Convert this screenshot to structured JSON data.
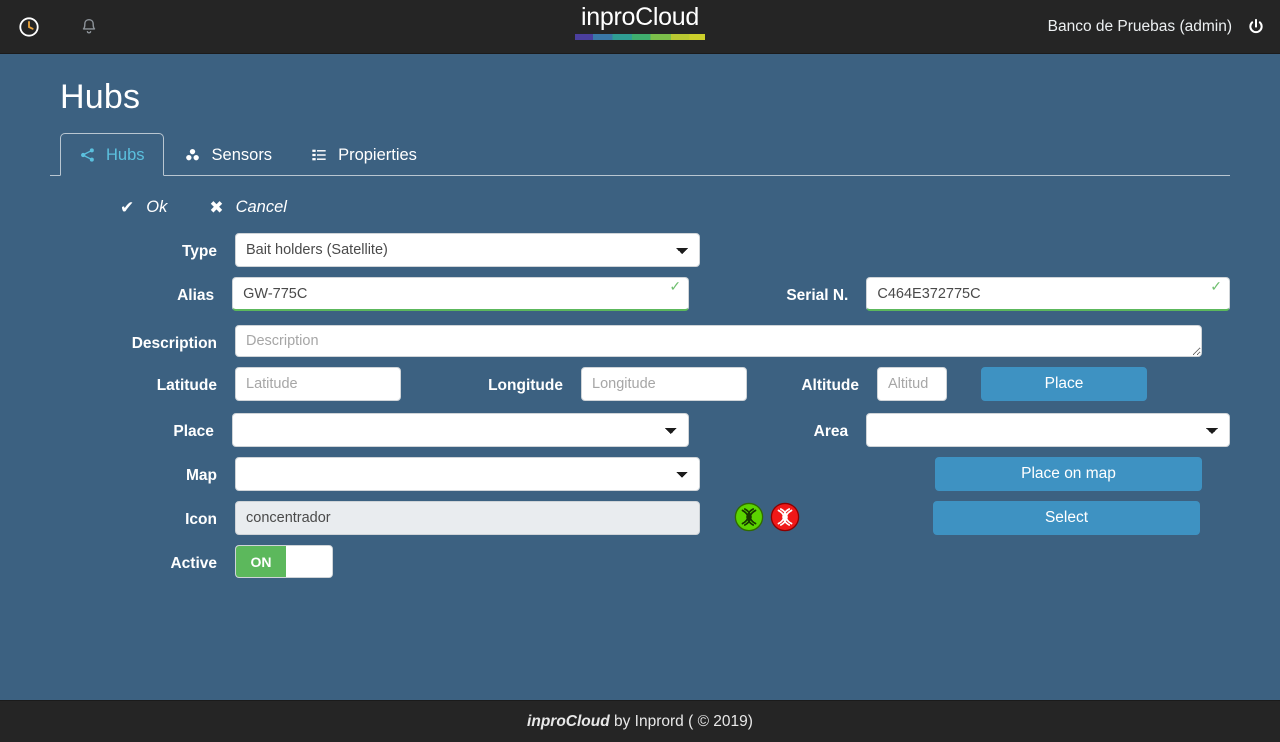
{
  "navbar": {
    "history_icon": "clock-icon",
    "bell_icon": "bell-icon",
    "brand": "inproCloud",
    "user": "Banco de Pruebas (admin)",
    "power_icon": "power-icon",
    "brand_gradient": [
      "#4b3f9e",
      "#3a78a8",
      "#2f9e94",
      "#3fae6e",
      "#7cbf4a",
      "#b9c832",
      "#cdd02b"
    ]
  },
  "page": {
    "title": "Hubs"
  },
  "tabs": [
    {
      "label": "Hubs",
      "icon": "share-nodes-icon",
      "active": true
    },
    {
      "label": "Sensors",
      "icon": "cubes-icon",
      "active": false
    },
    {
      "label": "Propierties",
      "icon": "list-icon",
      "active": false
    }
  ],
  "actions": [
    {
      "label": "Ok",
      "icon": "check-icon",
      "glyph": "✔"
    },
    {
      "label": "Cancel",
      "icon": "times-icon",
      "glyph": "✖"
    }
  ],
  "form": {
    "type": {
      "label": "Type",
      "value": "Bait holders (Satellite)"
    },
    "alias": {
      "label": "Alias",
      "value": "GW-775C",
      "valid": true,
      "valid_glyph": "✓"
    },
    "serial": {
      "label": "Serial N.",
      "value": "C464E372775C",
      "valid": true,
      "valid_glyph": "✓"
    },
    "description": {
      "label": "Description",
      "value": "",
      "placeholder": "Description"
    },
    "latitude": {
      "label": "Latitude",
      "value": "",
      "placeholder": "Latitude"
    },
    "longitude": {
      "label": "Longitude",
      "value": "",
      "placeholder": "Longitude"
    },
    "altitude": {
      "label": "Altitude",
      "value": "",
      "placeholder": "Altitud"
    },
    "place_button": {
      "label": "Place"
    },
    "place": {
      "label": "Place",
      "value": ""
    },
    "area": {
      "label": "Area",
      "value": ""
    },
    "map": {
      "label": "Map",
      "value": ""
    },
    "place_on_map_button": {
      "label": "Place on map"
    },
    "icon": {
      "label": "Icon",
      "value": "concentrador"
    },
    "icon_green": "hub-icon-green",
    "icon_red": "hub-icon-red",
    "select_button": {
      "label": "Select"
    },
    "active": {
      "label": "Active",
      "state": "ON"
    }
  },
  "colors": {
    "page_bg": "#3c6181",
    "navbar_bg": "#252525",
    "accent": "#3e92c2",
    "tab_active_text": "#5bc0de",
    "valid_green": "#5cb85c"
  },
  "footer": {
    "brand": "inproCloud",
    "rest": " by Inprord ( © 2019)"
  }
}
